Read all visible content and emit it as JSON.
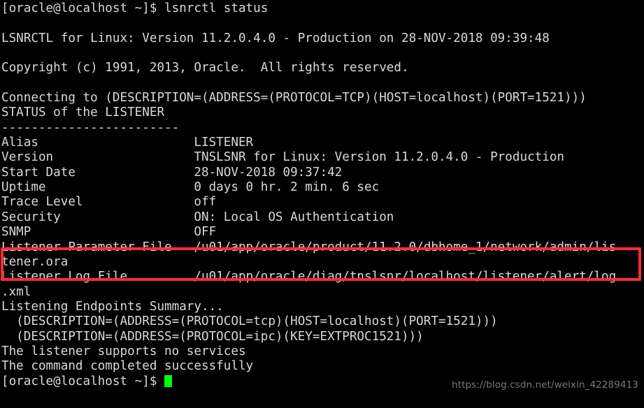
{
  "terminal": {
    "window_title": "oracle@localhost:~",
    "colors": {
      "background": "#000000",
      "foreground": "#d9d9d9",
      "cursor": "#00ff00",
      "highlight_border": "#fb2c36",
      "watermark": "#7a7a7a"
    },
    "prompt": "[oracle@localhost ~]$",
    "command": "lsnrctl status",
    "lines": [
      "[oracle@localhost ~]$ lsnrctl status",
      "",
      "LSNRCTL for Linux: Version 11.2.0.4.0 - Production on 28-NOV-2018 09:39:48",
      "",
      "Copyright (c) 1991, 2013, Oracle.  All rights reserved.",
      "",
      "Connecting to (DESCRIPTION=(ADDRESS=(PROTOCOL=TCP)(HOST=localhost)(PORT=1521)))",
      "STATUS of the LISTENER",
      "------------------------",
      "Alias                     LISTENER",
      "Version                   TNSLSNR for Linux: Version 11.2.0.4.0 - Production",
      "Start Date                28-NOV-2018 09:37:42",
      "Uptime                    0 days 0 hr. 2 min. 6 sec",
      "Trace Level               off",
      "Security                  ON: Local OS Authentication",
      "SNMP                      OFF",
      "Listener Parameter File   /u01/app/oracle/product/11.2.0/dbhome_1/network/admin/lis",
      "tener.ora",
      "Listener Log File         /u01/app/oracle/diag/tnslsnr/localhost/listener/alert/log",
      ".xml",
      "Listening Endpoints Summary...",
      "  (DESCRIPTION=(ADDRESS=(PROTOCOL=tcp)(HOST=localhost)(PORT=1521)))",
      "  (DESCRIPTION=(ADDRESS=(PROTOCOL=ipc)(KEY=EXTPROC1521)))",
      "The listener supports no services",
      "The command completed successfully"
    ],
    "final_prompt": "[oracle@localhost ~]$ ",
    "status_fields": [
      {
        "label": "Alias",
        "value": "LISTENER"
      },
      {
        "label": "Version",
        "value": "TNSLSNR for Linux: Version 11.2.0.4.0 - Production"
      },
      {
        "label": "Start Date",
        "value": "28-NOV-2018 09:37:42"
      },
      {
        "label": "Uptime",
        "value": "0 days 0 hr. 2 min. 6 sec"
      },
      {
        "label": "Trace Level",
        "value": "off"
      },
      {
        "label": "Security",
        "value": "ON: Local OS Authentication"
      },
      {
        "label": "SNMP",
        "value": "OFF"
      },
      {
        "label": "Listener Parameter File",
        "value": "/u01/app/oracle/product/11.2.0/dbhome_1/network/admin/listener.ora"
      },
      {
        "label": "Listener Log File",
        "value": "/u01/app/oracle/diag/tnslsnr/localhost/listener/alert/log.xml"
      }
    ],
    "highlight": {
      "target_label": "Listener Parameter File",
      "target_value": "/u01/app/oracle/product/11.2.0/dbhome_1/network/admin/listener.ora"
    },
    "watermark": "https://blog.csdn.net/weixin_42289413"
  }
}
